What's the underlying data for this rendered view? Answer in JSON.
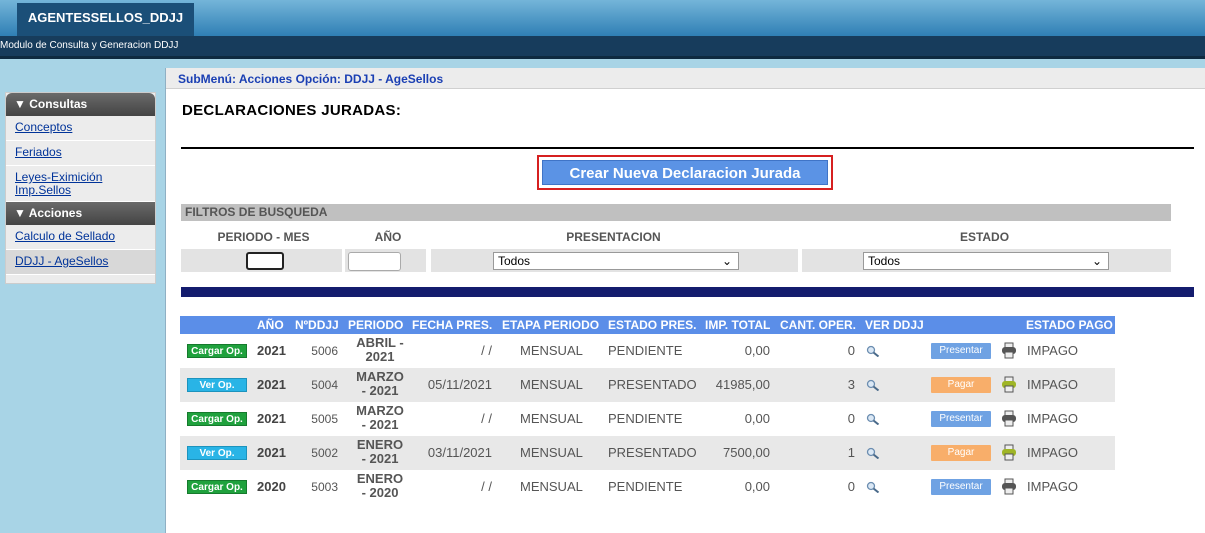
{
  "header": {
    "tab_title": "AGENTESSELLOS_DDJJ",
    "subtitle": "Modulo de Consulta y Generacion DDJJ"
  },
  "sidebar": {
    "sections": [
      {
        "title": "▼ Consultas",
        "items": [
          "Conceptos",
          "Feriados",
          "Leyes-Eximición Imp.Sellos"
        ]
      },
      {
        "title": "▼ Acciones",
        "items": [
          "Calculo de Sellado",
          "DDJJ - AgeSellos"
        ]
      }
    ]
  },
  "breadcrumb": "SubMenú: Acciones Opción: DDJJ - AgeSellos",
  "page_title": "DECLARACIONES JURADAS:",
  "create_button": "Crear Nueva Declaracion Jurada",
  "filters": {
    "heading": "FILTROS DE BUSQUEDA",
    "labels": {
      "periodo": "PERIODO - MES",
      "anio": "AÑO",
      "presentacion": "PRESENTACION",
      "estado": "ESTADO"
    },
    "presentacion_value": "Todos",
    "estado_value": "Todos"
  },
  "table": {
    "headers": [
      "AÑO",
      "NºDDJJ",
      "PERIODO",
      "FECHA PRES.",
      "ETAPA PERIODO",
      "ESTADO PRES.",
      "IMP. TOTAL",
      "CANT. OPER.",
      "VER DDJJ",
      "ESTADO PAGO"
    ],
    "rows": [
      {
        "op": "Cargar Op.",
        "op_style": "green",
        "anio": "2021",
        "ddjj": "5006",
        "periodo1": "ABRIL -",
        "periodo2": "2021",
        "fecha": "/ /",
        "etapa": "MENSUAL",
        "estado": "PENDIENTE",
        "total": "0,00",
        "cant": "0",
        "action": "Presentar",
        "action_style": "presentar",
        "pago": "IMPAGO"
      },
      {
        "op": "Ver Op.",
        "op_style": "cyan",
        "anio": "2021",
        "ddjj": "5004",
        "periodo1": "MARZO",
        "periodo2": "- 2021",
        "fecha": "05/11/2021",
        "etapa": "MENSUAL",
        "estado": "PRESENTADO",
        "total": "41985,00",
        "cant": "3",
        "action": "Pagar",
        "action_style": "pagar",
        "pago": "IMPAGO"
      },
      {
        "op": "Cargar Op.",
        "op_style": "green",
        "anio": "2021",
        "ddjj": "5005",
        "periodo1": "MARZO",
        "periodo2": "- 2021",
        "fecha": "/ /",
        "etapa": "MENSUAL",
        "estado": "PENDIENTE",
        "total": "0,00",
        "cant": "0",
        "action": "Presentar",
        "action_style": "presentar",
        "pago": "IMPAGO"
      },
      {
        "op": "Ver Op.",
        "op_style": "cyan",
        "anio": "2021",
        "ddjj": "5002",
        "periodo1": "ENERO",
        "periodo2": "- 2021",
        "fecha": "03/11/2021",
        "etapa": "MENSUAL",
        "estado": "PRESENTADO",
        "total": "7500,00",
        "cant": "1",
        "action": "Pagar",
        "action_style": "pagar",
        "pago": "IMPAGO"
      },
      {
        "op": "Cargar Op.",
        "op_style": "green",
        "anio": "2020",
        "ddjj": "5003",
        "periodo1": "ENERO",
        "periodo2": "- 2020",
        "fecha": "/ /",
        "etapa": "MENSUAL",
        "estado": "PENDIENTE",
        "total": "0,00",
        "cant": "0",
        "action": "Presentar",
        "action_style": "presentar",
        "pago": "IMPAGO"
      }
    ]
  },
  "colors": {
    "header_blue": "#5b8ee8",
    "green_button": "#1fa13d",
    "cyan_button": "#29b4e6",
    "presentar": "#6fa2e3",
    "pagar": "#f8ae6a",
    "highlight_border": "#d62020",
    "navy_bar": "#141c6e"
  },
  "icons": {
    "ver_ddjj": "magnifier-icon",
    "print": "printer-icon"
  }
}
